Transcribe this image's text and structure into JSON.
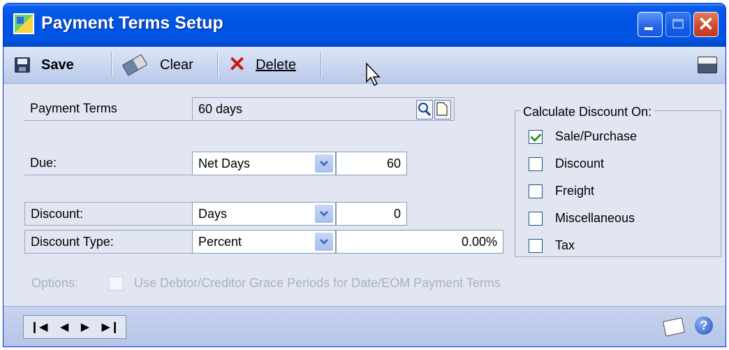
{
  "window": {
    "title": "Payment Terms Setup"
  },
  "toolbar": {
    "save_label": "Save",
    "clear_label": "Clear",
    "delete_label": "Delete"
  },
  "form": {
    "payment_terms": {
      "label": "Payment Terms",
      "value": "60 days"
    },
    "due": {
      "label": "Due:",
      "type_value": "Net Days",
      "days_value": "60"
    },
    "discount": {
      "label": "Discount:",
      "type_value": "Days",
      "days_value": "0"
    },
    "discount_type": {
      "label": "Discount Type:",
      "type_value": "Percent",
      "amount_value": "0.00%"
    }
  },
  "calculate_discount": {
    "title": "Calculate Discount On:",
    "items": [
      {
        "label": "Sale/Purchase",
        "checked": true
      },
      {
        "label": "Discount",
        "checked": false
      },
      {
        "label": "Freight",
        "checked": false
      },
      {
        "label": "Miscellaneous",
        "checked": false
      },
      {
        "label": "Tax",
        "checked": false
      }
    ]
  },
  "options": {
    "label": "Options:",
    "grace_label": "Use Debtor/Creditor Grace Periods for Date/EOM Payment Terms",
    "grace_checked": false
  },
  "icons": {
    "save": "save-disk-icon",
    "clear": "eraser-icon",
    "delete": "delete-x-icon",
    "print": "printer-icon",
    "lookup": "magnifier-icon",
    "new_doc": "new-document-icon",
    "note": "note-icon",
    "help": "help-icon"
  },
  "colors": {
    "titlebar": "#0054e3",
    "window_bg": "#e1e6f2",
    "close_button": "#d2452d",
    "check_mark": "#2e9a2e",
    "disabled_text": "#a9b1c3"
  }
}
